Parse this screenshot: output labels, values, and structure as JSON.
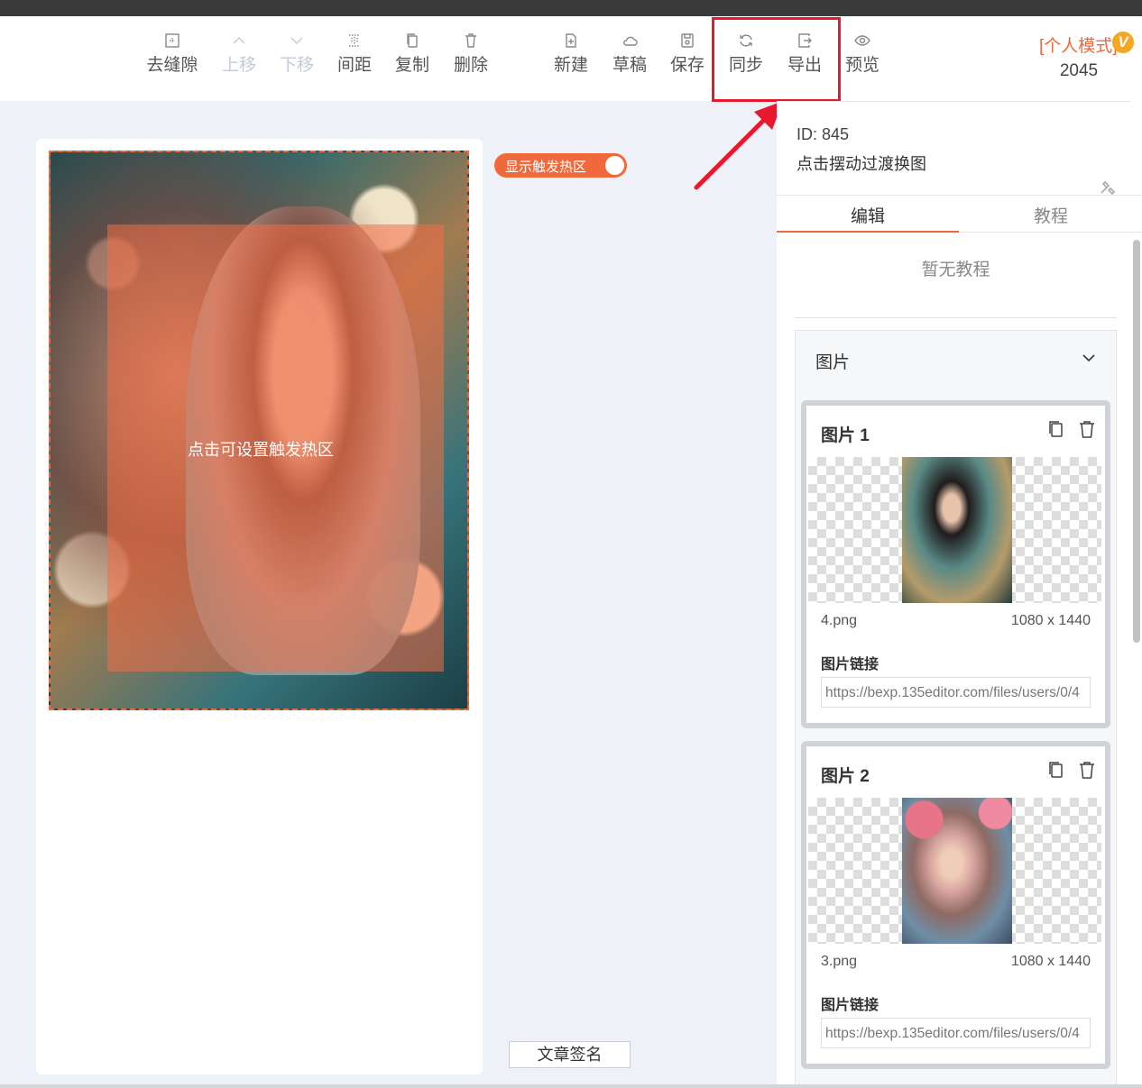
{
  "toolbar": {
    "items": [
      {
        "label": "去缝隙",
        "icon": "grid-icon",
        "disabled": false
      },
      {
        "label": "上移",
        "icon": "chevron-up-icon",
        "disabled": true
      },
      {
        "label": "下移",
        "icon": "chevron-down-icon",
        "disabled": true
      },
      {
        "label": "间距",
        "icon": "spacing-icon",
        "disabled": false
      },
      {
        "label": "复制",
        "icon": "copy-icon",
        "disabled": false
      },
      {
        "label": "删除",
        "icon": "trash-icon",
        "disabled": false
      },
      {
        "label": "新建",
        "icon": "new-file-icon",
        "disabled": false
      },
      {
        "label": "草稿",
        "icon": "cloud-icon",
        "disabled": false
      },
      {
        "label": "保存",
        "icon": "save-icon",
        "disabled": false
      },
      {
        "label": "同步",
        "icon": "sync-icon",
        "disabled": false
      },
      {
        "label": "导出",
        "icon": "export-icon",
        "disabled": false
      },
      {
        "label": "预览",
        "icon": "eye-icon",
        "disabled": false
      }
    ],
    "mode_label": "[个人模式]",
    "vip_badge": "V",
    "count": "2045"
  },
  "canvas": {
    "hotzone_label": "点击可设置触发热区",
    "toggle_label": "显示触发热区",
    "toggle_on": true,
    "signature_button": "文章签名"
  },
  "panel": {
    "id_text": "ID: 845",
    "name": "点击摆动过渡换图",
    "tabs": [
      {
        "label": "编辑",
        "active": true
      },
      {
        "label": "教程",
        "active": false
      }
    ],
    "no_tutorial": "暂无教程",
    "section_title": "图片",
    "images": [
      {
        "title": "图片 1",
        "file": "4.png",
        "size": "1080 x 1440",
        "link_label": "图片链接",
        "link": "https://bexp.135editor.com/files/users/0/4"
      },
      {
        "title": "图片 2",
        "file": "3.png",
        "size": "1080 x 1440",
        "link_label": "图片链接",
        "link": "https://bexp.135editor.com/files/users/0/4"
      }
    ]
  },
  "colors": {
    "accent": "#f0693b",
    "highlight": "#e8192c",
    "badge": "#f5a623"
  }
}
